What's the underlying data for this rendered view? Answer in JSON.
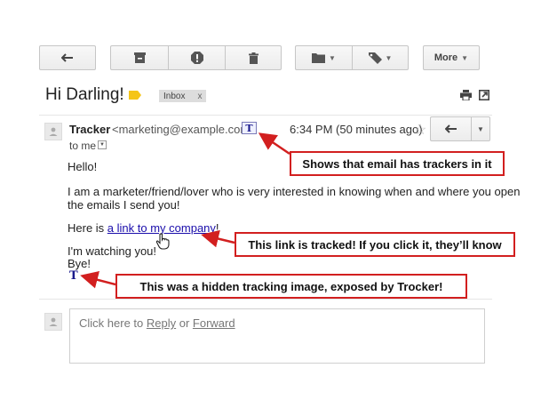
{
  "toolbar": {
    "back": "back-arrow-icon",
    "archive": "archive-icon",
    "spam": "report-spam-icon",
    "delete": "trash-icon",
    "move": "folder-icon",
    "labels": "label-tag-icon",
    "more_label": "More"
  },
  "subject": {
    "title": "Hi Darling!",
    "label_color": "#f5c518",
    "chip_label": "Inbox",
    "chip_close": "x"
  },
  "message": {
    "sender_name": "Tracker",
    "sender_email": "<marketing@example.com>",
    "trocker_badge": "T",
    "time": "6:34 PM (50 minutes ago)",
    "star": "☆",
    "to": "to me",
    "body": {
      "greeting": "Hello!",
      "para1_line1": "I am a marketer/friend/lover who is very interested in knowing when and where you open",
      "para1_line2": "the emails I send you!",
      "link_prefix": "Here is ",
      "link_text": "a link to my company",
      "link_suffix": "!",
      "watching": "I'm watching you!",
      "bye": "Bye!",
      "hidden_tracker": "T"
    }
  },
  "reply": {
    "prefix": "Click here to ",
    "reply_link": "Reply",
    "middle": " or ",
    "forward_link": "Forward"
  },
  "annotations": {
    "trackers": "Shows that email has trackers in it",
    "link": "This link is tracked! If you click it, they’ll know",
    "image": "This was a hidden tracking image, exposed by Trocker!",
    "color": "#d21f1f"
  }
}
